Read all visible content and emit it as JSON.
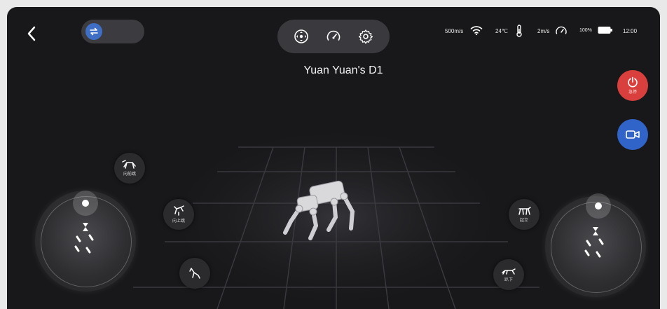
{
  "header": {
    "robot_name": "Yuan Yuan's D1",
    "mode_icons": [
      "joystick-mode-icon",
      "speedometer-icon",
      "gear-icon"
    ],
    "toggle_icon": "swap-arrows-icon"
  },
  "status_bar": {
    "network_speed": "500m/s",
    "temperature": "24℃",
    "move_speed": "2m/s",
    "battery": "100%",
    "time": "12:00"
  },
  "right_controls": {
    "stop_label": "急停",
    "stop_icon": "power-icon",
    "camera_icon": "video-camera-icon"
  },
  "actions": {
    "jump_forward": "向前跳",
    "jump_up": "向上跳",
    "stand_up": "起立",
    "lie_down": "趴下"
  },
  "colors": {
    "background": "#18181a",
    "stop": "#d9403d",
    "camera": "#3064c8",
    "toggle_accent": "#3f6fc4"
  }
}
